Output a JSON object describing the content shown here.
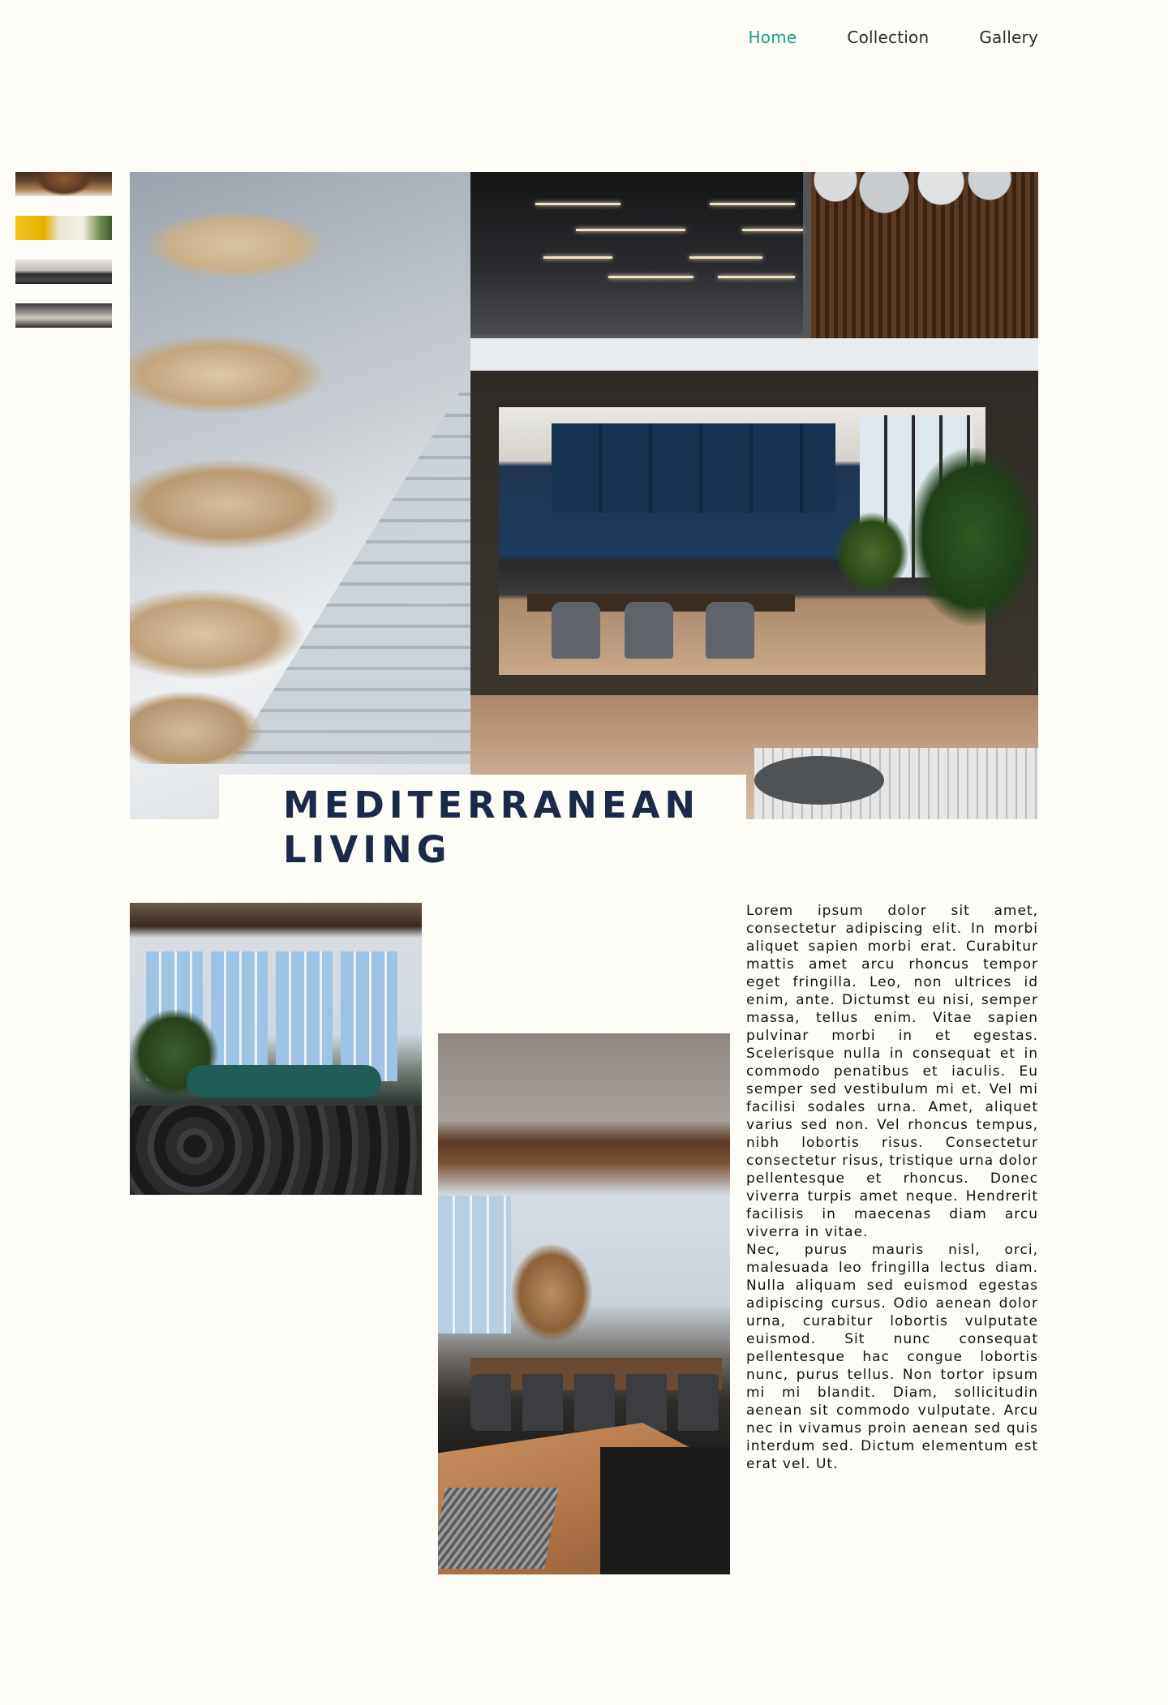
{
  "nav": {
    "items": [
      {
        "label": "Home",
        "active": true
      },
      {
        "label": "Collection",
        "active": false
      },
      {
        "label": "Gallery",
        "active": false
      }
    ],
    "active_color": "#1f9d8f"
  },
  "hero": {
    "title": "MEDITERRANEAN\nLIVING",
    "title_color": "#1b2a47"
  },
  "body_text": "Lorem ipsum dolor sit amet, consectetur adipiscing elit. In morbi aliquet sapien morbi erat. Curabitur mattis amet arcu rhoncus tempor eget fringilla. Leo, non ultrices id enim, ante. Dictumst eu nisi, semper massa, tellus enim. Vitae sapien pulvinar morbi in et egestas. Scelerisque nulla in consequat et in commodo penatibus et iaculis. Eu semper sed vestibulum mi et. Vel mi facilisi sodales urna. Amet, aliquet varius sed non. Vel rhoncus tempus, nibh lobortis risus. Consectetur consectetur risus, tristique urna dolor pellentesque et rhoncus. Donec viverra turpis amet neque. Hendrerit facilisis in maecenas diam arcu viverra in vitae.\nNec, purus mauris nisl, orci, malesuada leo fringilla lectus diam. Nulla aliquam sed euismod egestas adipiscing cursus. Odio aenean dolor urna, curabitur lobortis vulputate euismod. Sit nunc consequat pellentesque hac congue lobortis nunc, purus tellus. Non tortor ipsum mi mi blandit. Diam, sollicitudin aenean sit commodo vulputate. Arcu nec in vivamus proin aenean sed quis interdum sed. Dictum elementum est erat vel. Ut.",
  "colors": {
    "background": "#fdfcf6",
    "text": "#111111"
  }
}
